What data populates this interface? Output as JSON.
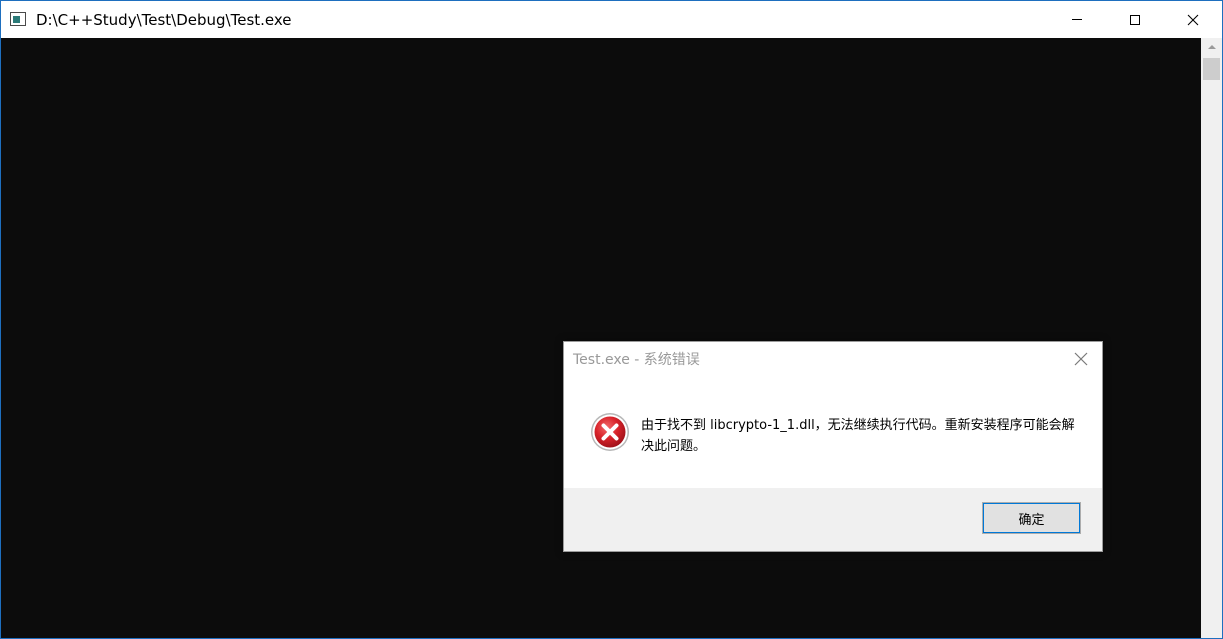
{
  "console_window": {
    "title": "D:\\C++Study\\Test\\Debug\\Test.exe",
    "icon": "console-app-icon",
    "background_color": "#0c0c0c",
    "caption_buttons": {
      "minimize_icon": "minimize-icon",
      "maximize_icon": "maximize-icon",
      "close_icon": "close-icon"
    }
  },
  "error_dialog": {
    "title": "Test.exe - 系统错误",
    "icon": "error-icon",
    "message": "由于找不到 libcrypto-1_1.dll，无法继续执行代码。重新安装程序可能会解决此问题。",
    "ok_label": "确定",
    "accent_color": "#0078d7",
    "error_color": "#d8232a"
  }
}
